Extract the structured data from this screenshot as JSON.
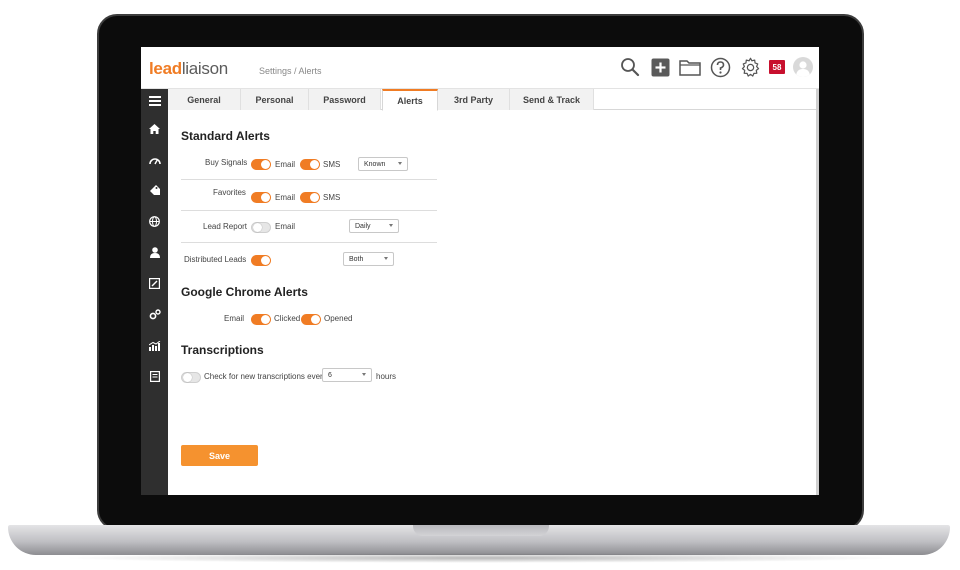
{
  "app": {
    "logo_lead": "lead",
    "logo_liaison": "liaison",
    "breadcrumb": "Settings / Alerts",
    "notification_count": "58",
    "accent_color": "#f07c24"
  },
  "topbar_icons": [
    "search-icon",
    "add-icon",
    "folder-icon",
    "help-icon",
    "gear-icon",
    "notification-badge",
    "avatar"
  ],
  "sidebar": {
    "items": [
      "menu-icon",
      "home-icon",
      "dashboard-icon",
      "tag-icon",
      "globe-icon",
      "user-icon",
      "edit-icon",
      "settings-gears-icon",
      "chart-icon",
      "report-icon"
    ]
  },
  "tabs": [
    {
      "label": "General",
      "active": false
    },
    {
      "label": "Personal",
      "active": false
    },
    {
      "label": "Password",
      "active": false
    },
    {
      "label": "Alerts",
      "active": true
    },
    {
      "label": "3rd Party",
      "active": false
    },
    {
      "label": "Send & Track",
      "active": false
    }
  ],
  "standard_alerts": {
    "title": "Standard Alerts",
    "buy_signals": {
      "label": "Buy Signals",
      "email": "Email",
      "sms": "SMS",
      "email_on": true,
      "sms_on": true,
      "select": "Known"
    },
    "favorites": {
      "label": "Favorites",
      "email": "Email",
      "sms": "SMS",
      "email_on": true,
      "sms_on": true
    },
    "lead_report": {
      "label": "Lead Report",
      "email": "Email",
      "email_on": false,
      "select": "Daily"
    },
    "distributed_leads": {
      "label": "Distributed Leads",
      "on": true,
      "select": "Both"
    }
  },
  "chrome_alerts": {
    "title": "Google Chrome Alerts",
    "email": "Email",
    "clicked": "Clicked",
    "opened": "Opened",
    "email_on": true,
    "clicked_on": true
  },
  "transcriptions": {
    "title": "Transcriptions",
    "check_label": "Check for new transcriptions every",
    "interval": "6",
    "unit": "hours",
    "on": false
  },
  "actions": {
    "save": "Save"
  }
}
